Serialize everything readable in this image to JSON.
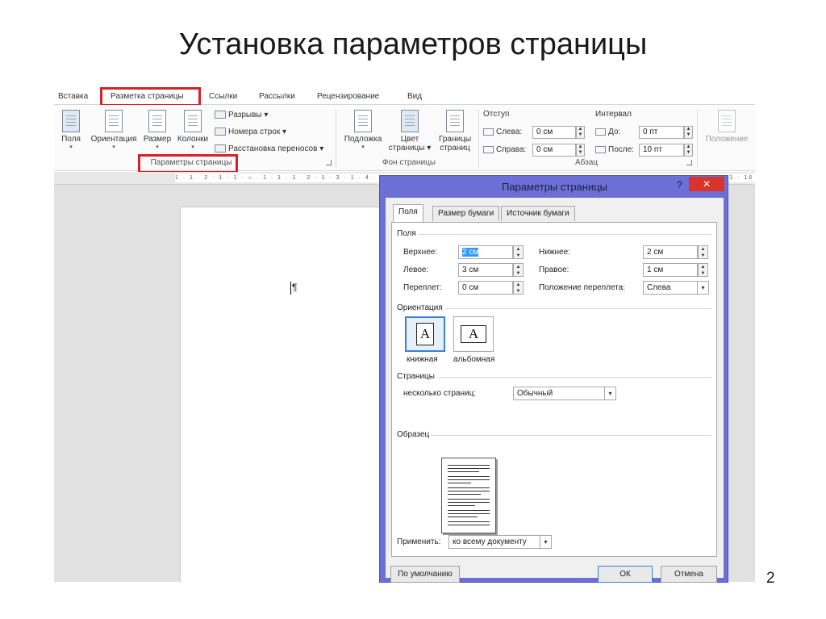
{
  "slide": {
    "title": "Установка параметров страницы",
    "number": "2"
  },
  "ribbon": {
    "tabs": [
      "Вставка",
      "Разметка страницы",
      "Ссылки",
      "Рассылки",
      "Рецензирование",
      "Вид"
    ],
    "page_setup": {
      "fields": "Поля",
      "orientation": "Ориентация",
      "size": "Размер",
      "columns": "Колонки",
      "breaks": "Разрывы ▾",
      "line_numbers": "Номера строк ▾",
      "hyphenation": "Расстановка переносов ▾",
      "group_label": "Параметры страницы"
    },
    "background": {
      "watermark": "Подложка",
      "page_color_1": "Цвет",
      "page_color_2": "страницы ▾",
      "borders_1": "Границы",
      "borders_2": "страниц",
      "group_label": "Фон страницы"
    },
    "paragraph": {
      "indent_title": "Отступ",
      "left_label": "Слева:",
      "left_value": "0 см",
      "right_label": "Справа:",
      "right_value": "0 см",
      "spacing_title": "Интервал",
      "before_label": "До:",
      "before_value": "0 пт",
      "after_label": "После:",
      "after_value": "10 пт",
      "group_label": "Абзац"
    },
    "position": "Положение"
  },
  "ruler": {
    "marks": "1 · 1 · 2 · 1 · 1 · ⌂ · 1 · 1 · 1 · 2 · 1 · 3 · 1 · 4 · 1 · 5 · 1 · 6 · 1 · 7 · 1 · 8 · 1 · 9 · 1 · 10 · 1 · 11 · 1 · 12 · 1 · 13 · 1 · 14 · 1 · 15 · 1 · 16 · 1 · 17"
  },
  "document": {
    "pilcrow": "¶"
  },
  "dialog": {
    "title": "Параметры страницы",
    "help": "?",
    "close": "✕",
    "tabs": [
      "Поля",
      "Размер бумаги",
      "Источник бумаги"
    ],
    "margins_section": "Поля",
    "top_label": "Верхнее:",
    "top_value": "2 см",
    "bottom_label": "Нижнее:",
    "bottom_value": "2 см",
    "left_label": "Левое:",
    "left_value": "3 см",
    "right_label": "Правое:",
    "right_value": "1 см",
    "gutter_label": "Переплет:",
    "gutter_value": "0 см",
    "gutter_pos_label": "Положение переплета:",
    "gutter_pos_value": "Слева",
    "orientation_section": "Ориентация",
    "portrait": "книжная",
    "landscape": "альбомная",
    "glyph": "A",
    "pages_section": "Страницы",
    "multiple_pages_label": "несколько страниц:",
    "multiple_pages_value": "Обычный",
    "preview_section": "Образец",
    "apply_label": "Применить:",
    "apply_value": "ко всему документу",
    "default_button": "По умолчанию",
    "ok_button": "ОК",
    "cancel_button": "Отмена"
  },
  "colors": {
    "highlight": "#d8202a",
    "dialog_frame": "#6b6fd6",
    "close": "#d9332a",
    "selection": "#3399ff"
  }
}
